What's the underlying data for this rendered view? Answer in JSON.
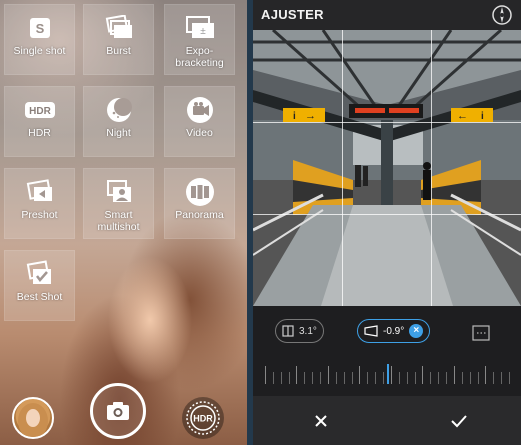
{
  "modes": [
    {
      "label": "Single shot",
      "icon": "single-shot-icon"
    },
    {
      "label": "Burst",
      "icon": "burst-icon"
    },
    {
      "label": "Expo-\nbracketing",
      "icon": "expo-bracketing-icon"
    },
    {
      "label": "HDR",
      "icon": "hdr-icon"
    },
    {
      "label": "Night",
      "icon": "night-icon"
    },
    {
      "label": "Video",
      "icon": "video-icon"
    },
    {
      "label": "Preshot",
      "icon": "preshot-icon"
    },
    {
      "label": "Smart\nmultishot",
      "icon": "smart-multishot-icon"
    },
    {
      "label": "Panorama",
      "icon": "panorama-icon"
    },
    {
      "label": "Best Shot",
      "icon": "best-shot-icon"
    }
  ],
  "bottom": {
    "gallery_icon": "gallery-thumbnail",
    "shutter_icon": "camera-icon",
    "hdr_badge": "HDR"
  },
  "adjust": {
    "title": "AJUSTER",
    "vertical_value": "3.1°",
    "horizontal_value": "-0.9°",
    "slider_value_fraction": 0.5,
    "cancel_icon": "close-icon",
    "confirm_icon": "check-icon",
    "accent": "#3ea0e6"
  },
  "photo": {
    "sign_left": "i",
    "sign_right": "i"
  }
}
